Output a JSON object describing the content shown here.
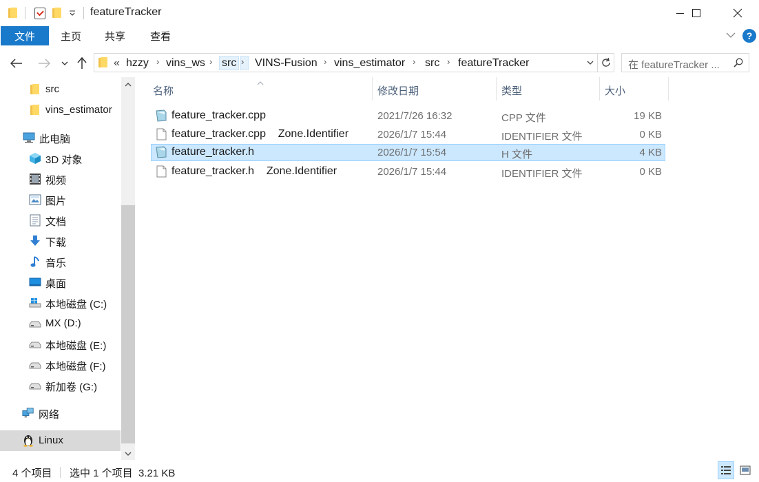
{
  "window": {
    "title": "featureTracker"
  },
  "ribbon": {
    "tabs": [
      {
        "label": "文件",
        "active": true
      },
      {
        "label": "主页"
      },
      {
        "label": "共享"
      },
      {
        "label": "查看"
      }
    ],
    "help": "?"
  },
  "address": {
    "overflow": "«",
    "crumbs": [
      "hzzy",
      "vins_ws",
      "src",
      "VINS-Fusion",
      "vins_estimator",
      "src",
      "featureTracker"
    ],
    "highlighted_index": 2
  },
  "search": {
    "placeholder": "在 featureTracker ..."
  },
  "nav": {
    "items": [
      {
        "label": "src",
        "icon": "folder-icon"
      },
      {
        "label": "vins_estimator",
        "icon": "folder-icon"
      },
      {
        "label": "此电脑",
        "icon": "this-pc-icon"
      },
      {
        "label": "3D 对象",
        "icon": "3d-objects-icon"
      },
      {
        "label": "视频",
        "icon": "videos-icon"
      },
      {
        "label": "图片",
        "icon": "pictures-icon"
      },
      {
        "label": "文档",
        "icon": "documents-icon"
      },
      {
        "label": "下载",
        "icon": "downloads-icon"
      },
      {
        "label": "音乐",
        "icon": "music-icon"
      },
      {
        "label": "桌面",
        "icon": "desktop-icon"
      },
      {
        "label": "本地磁盘 (C:)",
        "icon": "windows-drive-icon"
      },
      {
        "label": "MX (D:)",
        "icon": "drive-icon"
      },
      {
        "label": "本地磁盘 (E:)",
        "icon": "drive-icon"
      },
      {
        "label": "本地磁盘 (F:)",
        "icon": "drive-icon"
      },
      {
        "label": "新加卷 (G:)",
        "icon": "drive-icon"
      },
      {
        "label": "网络",
        "icon": "network-icon"
      },
      {
        "label": "Linux",
        "icon": "linux-icon",
        "selected": true
      }
    ]
  },
  "columns": {
    "name": "名称",
    "date": "修改日期",
    "type": "类型",
    "size": "大小"
  },
  "files": [
    {
      "name": "feature_tracker.cpp",
      "date": "2021/7/26 16:32",
      "type": "CPP 文件",
      "size": "19 KB",
      "icon": "source-file-icon"
    },
    {
      "name": "feature_tracker.cpp    Zone.Identifier",
      "date": "2026/1/7 15:44",
      "type": "IDENTIFIER 文件",
      "size": "0 KB",
      "icon": "blank-file-icon"
    },
    {
      "name": "feature_tracker.h",
      "date": "2026/1/7 15:54",
      "type": "H 文件",
      "size": "4 KB",
      "icon": "source-file-icon",
      "selected": true
    },
    {
      "name": "feature_tracker.h    Zone.Identifier",
      "date": "2026/1/7 15:44",
      "type": "IDENTIFIER 文件",
      "size": "0 KB",
      "icon": "blank-file-icon"
    }
  ],
  "status": {
    "count": "4 个项目",
    "selection": "选中 1 个项目  3.21 KB"
  },
  "colors": {
    "accent": "#1979ca",
    "selection": "#cce8ff",
    "selection_border": "#99d1ff"
  }
}
